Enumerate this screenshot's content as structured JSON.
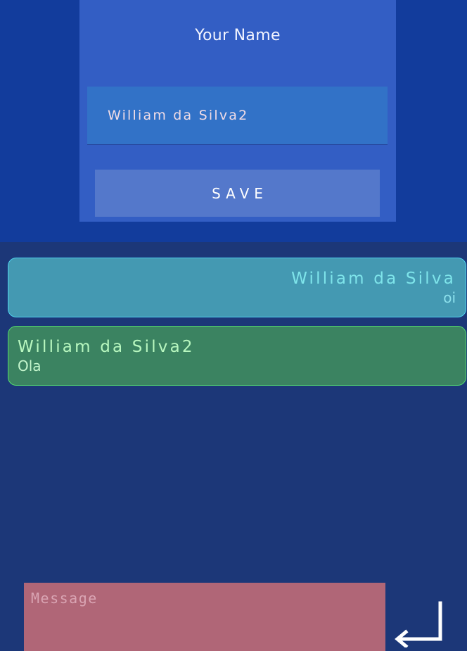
{
  "profile": {
    "title": "Your Name",
    "name_value": "William da Silva2",
    "save_label": "SAVE"
  },
  "messages": [
    {
      "author": "William da Silva",
      "text": "oi",
      "own": true
    },
    {
      "author": "William da Silva2",
      "text": "Ola",
      "own": false
    }
  ],
  "composer": {
    "placeholder": "Message",
    "send_icon": "enter-return-icon"
  },
  "colors": {
    "header_background": "#123c9c",
    "card_background": "#335ec4",
    "input_background": "#3272c7",
    "save_button": "#5478cb",
    "chat_background": "#1c3778",
    "own_message": "#4499b2",
    "own_message_border": "#4fd2ee",
    "other_message": "#3b8361",
    "other_message_border": "#55db70",
    "composer_background": "#b06677"
  }
}
